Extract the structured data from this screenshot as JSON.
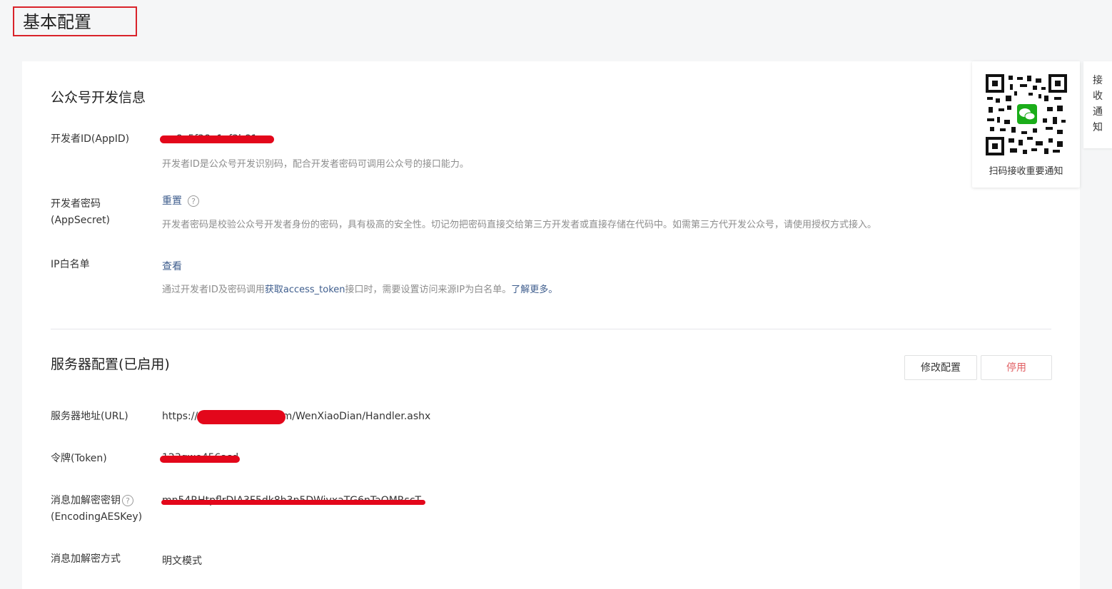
{
  "page": {
    "title": "基本配置"
  },
  "dev_info": {
    "title": "公众号开发信息",
    "appid": {
      "label": "开发者ID(AppID)",
      "value": "wx8c5f38a1cf3b81ea",
      "desc": "开发者ID是公众号开发识别码，配合开发者密码可调用公众号的接口能力。"
    },
    "appsecret": {
      "label_line1": "开发者密码",
      "label_line2": "(AppSecret)",
      "reset_link": "重置",
      "help": "?",
      "desc": "开发者密码是校验公众号开发者身份的密码，具有极高的安全性。切记勿把密码直接交给第三方开发者或直接存储在代码中。如需第三方代开发公众号，请使用授权方式接入。"
    },
    "ip_whitelist": {
      "label": "IP白名单",
      "view_link": "查看",
      "desc_prefix": "通过开发者ID及密码调用",
      "desc_link": "获取access_token",
      "desc_middle": "接口时，需要设置访问来源IP为白名单。",
      "learn_more": "了解更多。"
    }
  },
  "server_config": {
    "title": "服务器配置(已启用)",
    "modify_button": "修改配置",
    "disable_button": "停用",
    "url": {
      "label": "服务器地址(URL)",
      "value": "https://www.example.com/WenXiaoDian/Handler.ashx"
    },
    "token": {
      "label": "令牌(Token)",
      "value": "123qwe456asd"
    },
    "aeskey": {
      "label_line1": "消息加解密密钥",
      "label_line2": "(EncodingAESKey)",
      "help": "?",
      "value": "mn54RHtpflrDIA3F5dk8h3n5DWivxaTG6nTaOMRscT"
    },
    "encrypt_mode": {
      "label": "消息加解密方式",
      "value": "明文模式"
    }
  },
  "qr_panel": {
    "caption": "扫码接收重要通知"
  },
  "notify_tab": {
    "chars": [
      "接",
      "收",
      "通",
      "知"
    ]
  },
  "colors": {
    "accent_red": "#d9232a",
    "link_blue": "#3e5d8d",
    "wechat_green": "#1aad19"
  }
}
